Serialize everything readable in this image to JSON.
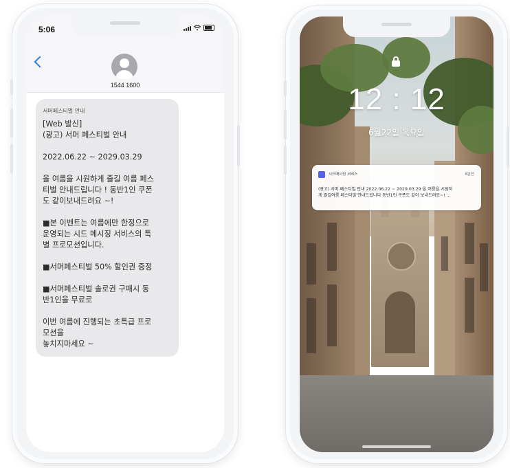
{
  "left_phone": {
    "status_time": "5:06",
    "sender_number": "1544 1600",
    "message": {
      "title": "서머페스티벌 안내",
      "body": "[Web 발신]\n(광고) 서머 페스티벌 안내\n\n2022.06.22 ~ 2029.03.29\n\n올 여름을 시원하게 즐길 여름 페스\n티벌 안내드립니다 ! 동반1인 쿠폰\n도 같이보내드려요 ~!\n\n■본 이벤트는 여름에만 한정으로\n운영되는 시드 메시징 서비스의 특\n별 프로모션입니다.\n\n■서머페스티벌 50% 할인권 증정\n\n■서머페스티벌 솔로권 구매시 동\n반1인을 무료로\n\n이번 여름에 진행되는 초특급 프로\n모션을\n놓치지마세요 ~"
    }
  },
  "right_phone": {
    "clock": "12 : 12",
    "date": "6월22일 목요일",
    "notification": {
      "app_name": "시드메시징 서비스",
      "ago": "8분전",
      "text": "(광고) 서머 페스티벌 안내 2022.06.22 ~ 2029.03.29 올 여름을 시원하\n게 즐길여름 페스티벌 안내드립니다 동반1인 쿠폰도 같이 보내드려요~! ..."
    }
  },
  "colors": {
    "back_chevron": "#2a78e4",
    "bubble": "#e9e9eb",
    "app_icon": "#5561e8"
  },
  "icons": [
    "back-chevron-icon",
    "avatar-icon",
    "signal-icon",
    "wifi-icon",
    "battery-icon",
    "lock-icon",
    "app-icon"
  ]
}
